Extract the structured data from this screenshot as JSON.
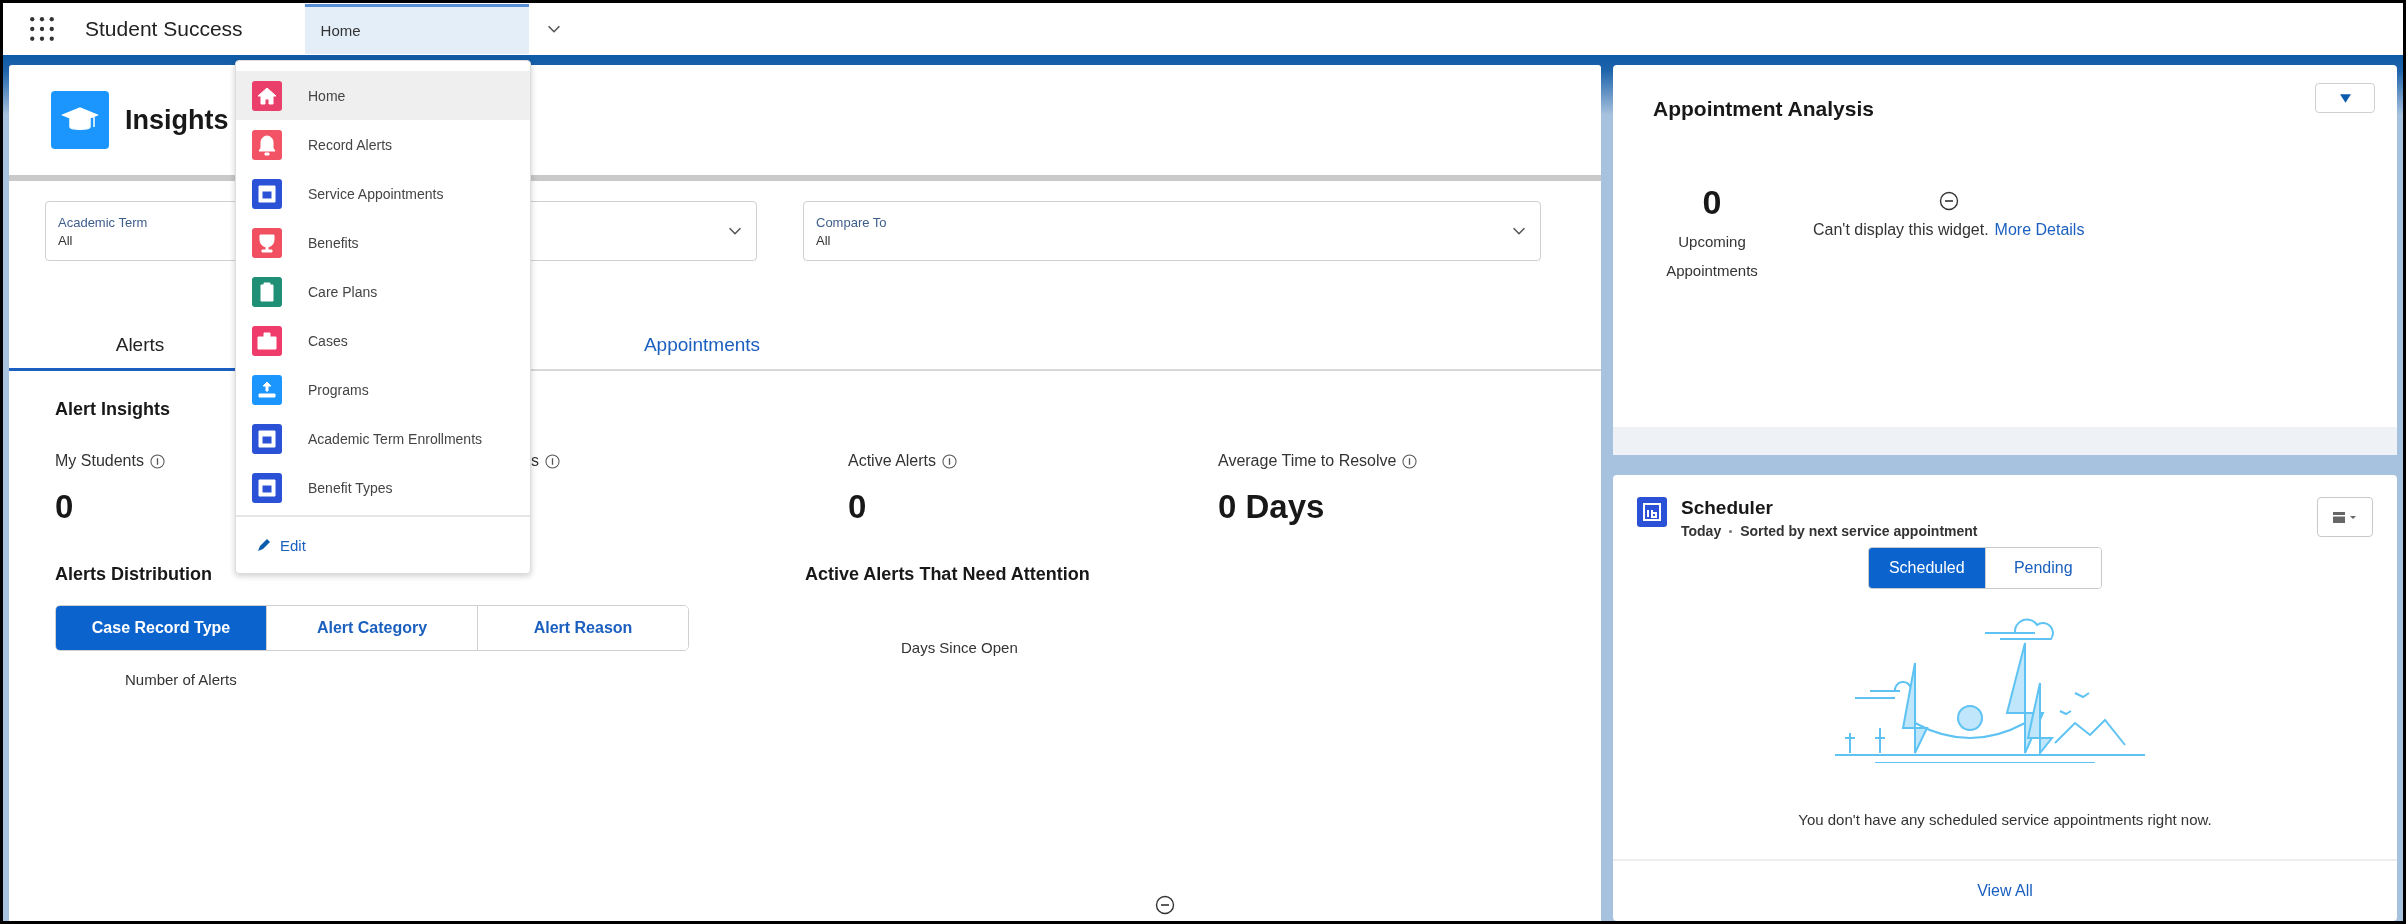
{
  "app": {
    "name": "Student Success"
  },
  "nav_tab": {
    "label": "Home",
    "selected": true
  },
  "nav_menu": {
    "items": [
      {
        "label": "Home",
        "kind": "home",
        "color": "#ea3f6a",
        "selected": true
      },
      {
        "label": "Record Alerts",
        "kind": "bell",
        "color": "#f25466",
        "selected": false
      },
      {
        "label": "Service Appointments",
        "kind": "calendar",
        "color": "#2b52d6",
        "selected": false
      },
      {
        "label": "Benefits",
        "kind": "trophy",
        "color": "#f0505f",
        "selected": false
      },
      {
        "label": "Care Plans",
        "kind": "clipboard",
        "color": "#1f8f76",
        "selected": false
      },
      {
        "label": "Cases",
        "kind": "case",
        "color": "#f03c6b",
        "selected": false
      },
      {
        "label": "Programs",
        "kind": "program",
        "color": "#1b96ff",
        "selected": false
      },
      {
        "label": "Academic Term Enrollments",
        "kind": "calendar",
        "color": "#2b52d6",
        "selected": false
      },
      {
        "label": "Benefit Types",
        "kind": "calendar",
        "color": "#2b52d6",
        "selected": false
      }
    ],
    "footer": "Edit"
  },
  "page_header": {
    "title": "Insights"
  },
  "filters": [
    {
      "kind": "dropdown",
      "label": "Academic Term",
      "value": "All"
    },
    {
      "kind": "dropdown"
    },
    {
      "kind": "dropdown",
      "label": "Compare To",
      "value": "All"
    }
  ],
  "tabs": [
    {
      "label": "Alerts",
      "selected": true
    },
    {
      "label": "Appointments",
      "selected": false
    }
  ],
  "alert_insights": {
    "title": "Alert Insights",
    "metrics": [
      {
        "label": "My Students",
        "value": "0"
      },
      {
        "label": "s"
      },
      {
        "label": "Active Alerts",
        "value": "0"
      },
      {
        "label": "Average Time to Resolve",
        "value": "0 Days"
      }
    ]
  },
  "alerts_distribution": {
    "title": "Alerts Distribution",
    "segments": [
      {
        "label": "Case Record Type",
        "selected": true
      },
      {
        "label": "Alert Category",
        "selected": false
      },
      {
        "label": "Alert Reason",
        "selected": false
      }
    ],
    "axis_label": "Number of Alerts"
  },
  "attention": {
    "title": "Active Alerts That Need Attention",
    "axis_label": "Days Since Open"
  },
  "appointment_analysis": {
    "title": "Appointment Analysis",
    "count": "0",
    "count_label": "Upcoming Appointments",
    "message": "Can't display this widget.",
    "link": "More Details"
  },
  "scheduler": {
    "title": "Scheduler",
    "subtitle_day": "Today",
    "subtitle_sort": "Sorted by next service appointment",
    "segments": [
      {
        "label": "Scheduled",
        "selected": true
      },
      {
        "label": "Pending",
        "selected": false
      }
    ],
    "empty_message": "You don't have any scheduled service appointments right now.",
    "footer_link": "View All"
  }
}
